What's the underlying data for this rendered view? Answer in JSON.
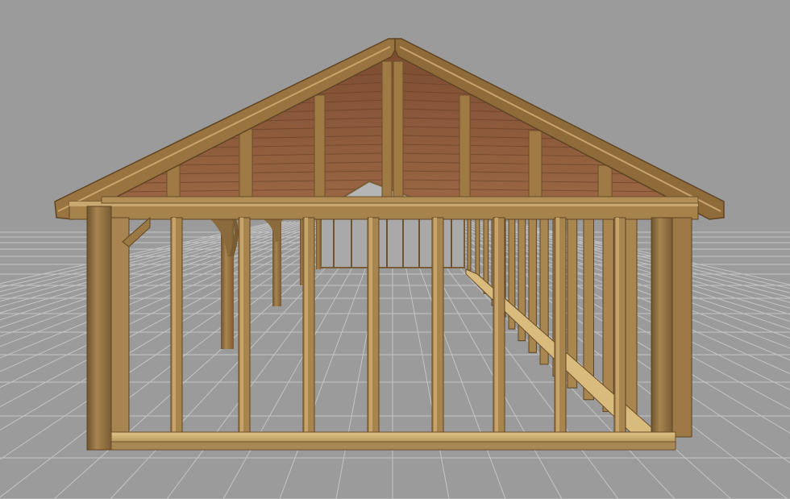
{
  "viewport": {
    "background": "#9b9b9b",
    "grid_color": "#b8b8b8",
    "grid_fill": "#8e8e8e"
  },
  "model": {
    "timber_color": "#8a6a3a",
    "timber_light": "#c2a06a",
    "timber_dark": "#5e4423",
    "roof_boards": "#8a5a3c",
    "roof_boards_dark": "#6b4128"
  }
}
